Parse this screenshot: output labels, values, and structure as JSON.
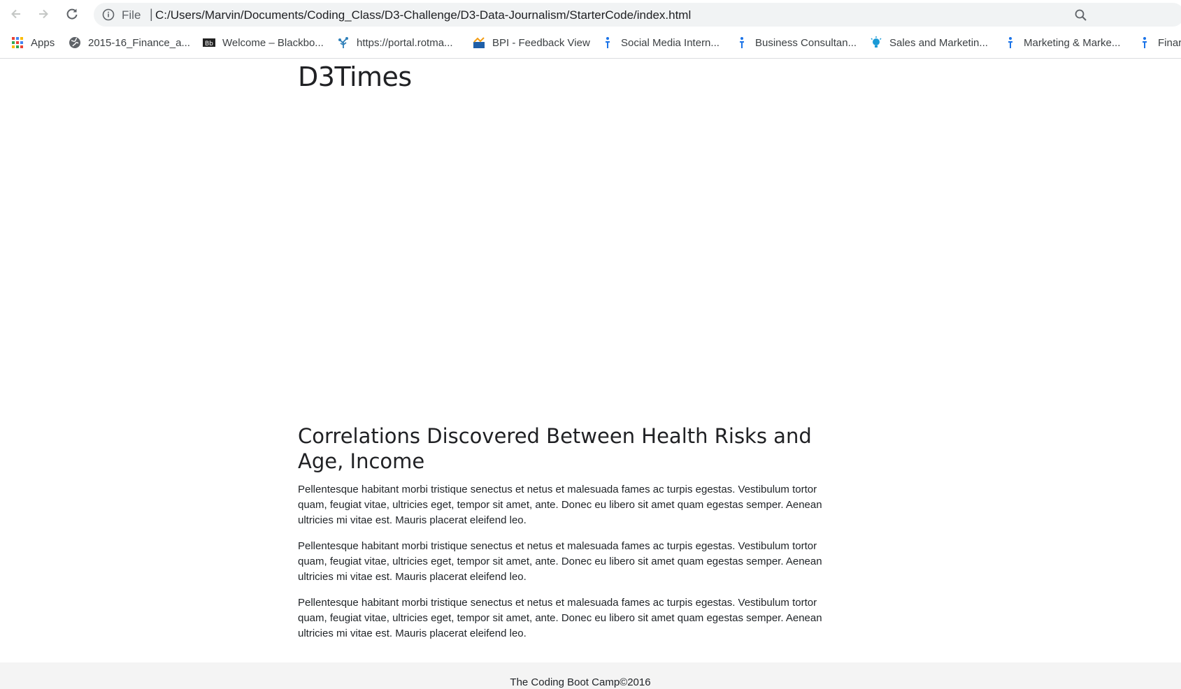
{
  "browser": {
    "scheme_label": "File",
    "url": "C:/Users/Marvin/Documents/Coding_Class/D3-Challenge/D3-Data-Journalism/StarterCode/index.html"
  },
  "bookmarks": [
    {
      "label": "Apps",
      "icon": "apps-grid-icon"
    },
    {
      "label": "2015-16_Finance_a...",
      "icon": "globe-icon"
    },
    {
      "label": "Welcome – Blackbo...",
      "icon": "blackboard-icon"
    },
    {
      "label": "https://portal.rotma...",
      "icon": "tree-icon"
    },
    {
      "label": "BPI - Feedback View",
      "icon": "bpi-icon"
    },
    {
      "label": "Social Media Intern...",
      "icon": "info-person-icon"
    },
    {
      "label": "Business Consultan...",
      "icon": "info-person-icon"
    },
    {
      "label": "Sales and Marketin...",
      "icon": "lightbulb-icon"
    },
    {
      "label": "Marketing & Marke...",
      "icon": "info-person-icon"
    },
    {
      "label": "Finar",
      "icon": "info-person-icon"
    }
  ],
  "page": {
    "title": "D3Times",
    "article_heading": "Correlations Discovered Between Health Risks and Age, Income",
    "paragraphs": [
      "Pellentesque habitant morbi tristique senectus et netus et malesuada fames ac turpis egestas. Vestibulum tortor quam, feugiat vitae, ultricies eget, tempor sit amet, ante. Donec eu libero sit amet quam egestas semper. Aenean ultricies mi vitae est. Mauris placerat eleifend leo.",
      "Pellentesque habitant morbi tristique senectus et netus et malesuada fames ac turpis egestas. Vestibulum tortor quam, feugiat vitae, ultricies eget, tempor sit amet, ante. Donec eu libero sit amet quam egestas semper. Aenean ultricies mi vitae est. Mauris placerat eleifend leo.",
      "Pellentesque habitant morbi tristique senectus et netus et malesuada fames ac turpis egestas. Vestibulum tortor quam, feugiat vitae, ultricies eget, tempor sit amet, ante. Donec eu libero sit amet quam egestas semper. Aenean ultricies mi vitae est. Mauris placerat eleifend leo."
    ],
    "footer": "The Coding Boot Camp©2016"
  }
}
